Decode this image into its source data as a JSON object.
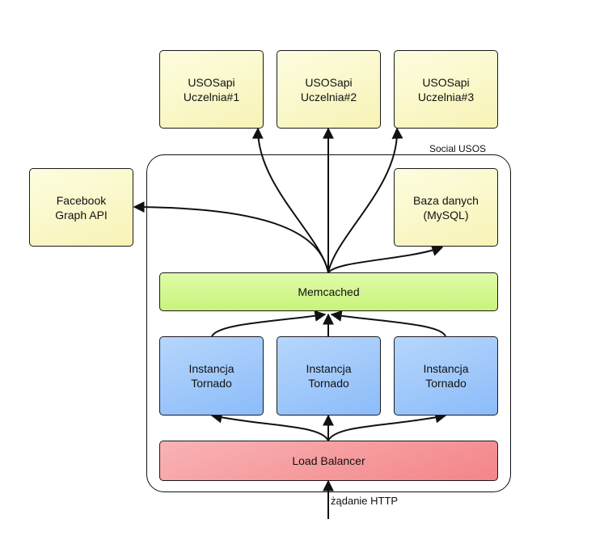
{
  "diagram": {
    "container_label": "Social USOS",
    "nodes": {
      "usosapi_1": "USOSapi\nUczelnia#1",
      "usosapi_2": "USOSapi\nUczelnia#2",
      "usosapi_3": "USOSapi\nUczelnia#3",
      "facebook": "Facebook\nGraph API",
      "database": "Baza danych\n(MySQL)",
      "memcached": "Memcached",
      "tornado_1": "Instancja\nTornado",
      "tornado_2": "Instancja\nTornado",
      "tornado_3": "Instancja\nTornado",
      "load_balancer": "Load Balancer"
    },
    "incoming_label": "żądanie HTTP",
    "edges": [
      {
        "from": "http-request",
        "to": "load_balancer"
      },
      {
        "from": "load_balancer",
        "to": "tornado_1"
      },
      {
        "from": "load_balancer",
        "to": "tornado_2"
      },
      {
        "from": "load_balancer",
        "to": "tornado_3"
      },
      {
        "from": "tornado_1",
        "to": "memcached"
      },
      {
        "from": "tornado_2",
        "to": "memcached"
      },
      {
        "from": "tornado_3",
        "to": "memcached"
      },
      {
        "from": "memcached",
        "to": "usosapi_1"
      },
      {
        "from": "memcached",
        "to": "usosapi_2"
      },
      {
        "from": "memcached",
        "to": "usosapi_3"
      },
      {
        "from": "memcached",
        "to": "facebook"
      },
      {
        "from": "memcached",
        "to": "database"
      }
    ],
    "colors": {
      "external_service": "#f7f3b6",
      "cache": "#c8f37c",
      "app_instance": "#8cbcf9",
      "load_balancer": "#f38588"
    }
  }
}
